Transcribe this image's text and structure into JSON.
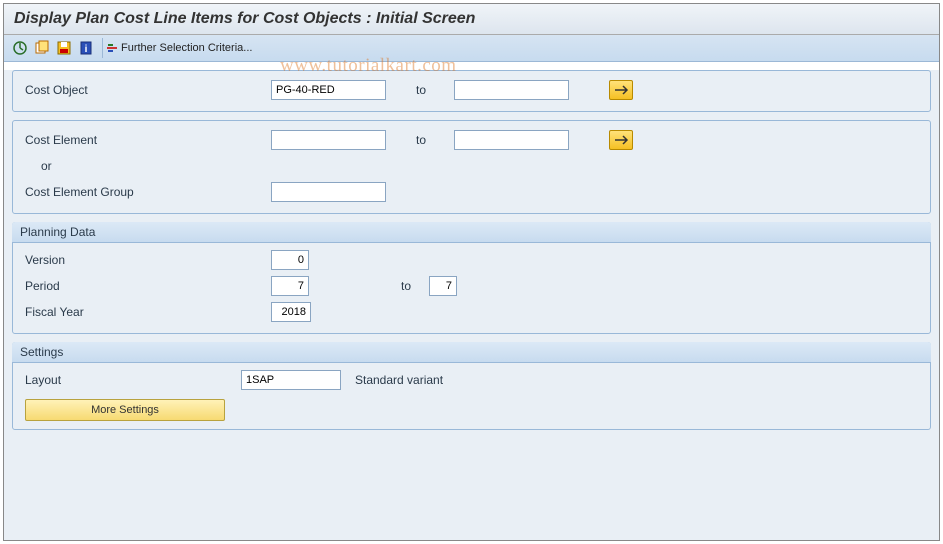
{
  "title": "Display Plan Cost Line Items for Cost Objects : Initial Screen",
  "toolbar": {
    "further": "Further Selection Criteria..."
  },
  "watermark": "www.tutorialkart.com",
  "selection": {
    "cost_object": {
      "label": "Cost Object",
      "from": "PG-40-RED",
      "to_label": "to",
      "to": ""
    },
    "cost_element": {
      "label": "Cost Element",
      "from": "",
      "to_label": "to",
      "to": ""
    },
    "or_label": "or",
    "cost_element_group": {
      "label": "Cost Element Group",
      "value": ""
    }
  },
  "planning": {
    "header": "Planning Data",
    "version": {
      "label": "Version",
      "value": "0"
    },
    "period": {
      "label": "Period",
      "from": "7",
      "to_label": "to",
      "to": "7"
    },
    "fiscal_year": {
      "label": "Fiscal Year",
      "value": "2018"
    }
  },
  "settings": {
    "header": "Settings",
    "layout": {
      "label": "Layout",
      "value": "1SAP",
      "desc": "Standard variant"
    },
    "more_btn": "More Settings"
  }
}
